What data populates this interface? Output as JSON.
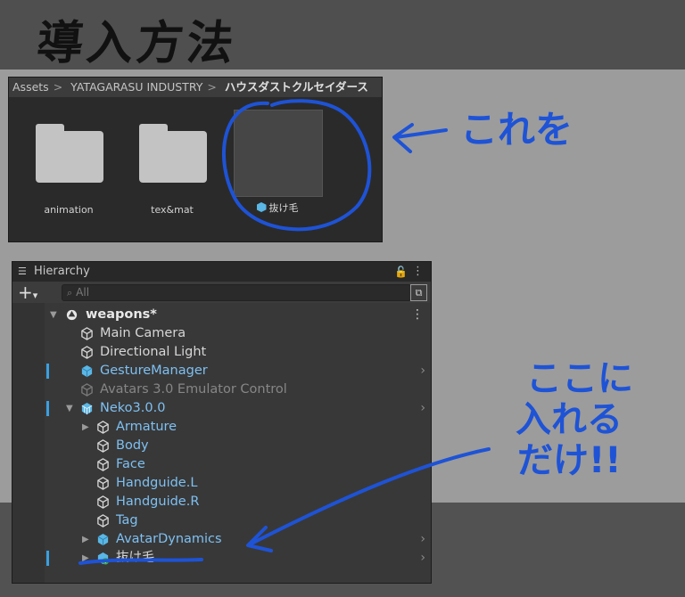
{
  "title": "導入方法",
  "project": {
    "breadcrumb": [
      "Assets",
      "YATAGARASU INDUSTRY",
      "ハウスダストクルセイダース"
    ],
    "items": [
      {
        "label": "animation",
        "type": "folder"
      },
      {
        "label": "tex&mat",
        "type": "folder"
      },
      {
        "label": "抜け毛",
        "type": "prefab"
      }
    ]
  },
  "hierarchy": {
    "tab_label": "Hierarchy",
    "search_placeholder": "All",
    "scene": "weapons*",
    "rows": [
      {
        "label": "Main Camera",
        "icon": "gameobject-cube-icon",
        "style": "normal"
      },
      {
        "label": "Directional Light",
        "icon": "gameobject-cube-icon",
        "style": "normal"
      },
      {
        "label": "GestureManager",
        "icon": "prefab-cube-icon",
        "style": "prefab"
      },
      {
        "label": "Avatars 3.0 Emulator Control",
        "icon": "gameobject-cube-icon",
        "style": "disabled"
      },
      {
        "label": "Neko3.0.0",
        "icon": "prefab-model-icon",
        "style": "prefab"
      },
      {
        "label": "Armature",
        "icon": "gameobject-cube-icon",
        "style": "prefab"
      },
      {
        "label": "Body",
        "icon": "gameobject-cube-icon",
        "style": "prefab"
      },
      {
        "label": "Face",
        "icon": "gameobject-cube-icon",
        "style": "prefab"
      },
      {
        "label": "Handguide.L",
        "icon": "gameobject-cube-icon",
        "style": "prefab"
      },
      {
        "label": "Handguide.R",
        "icon": "gameobject-cube-icon",
        "style": "prefab"
      },
      {
        "label": "Tag",
        "icon": "gameobject-cube-icon",
        "style": "prefab"
      },
      {
        "label": "AvatarDynamics",
        "icon": "prefab-cube-icon",
        "style": "prefab"
      },
      {
        "label": "抜け毛",
        "icon": "prefab-added-icon",
        "style": "prefab"
      }
    ]
  },
  "annotations": {
    "this_label": "これを",
    "instruction_line1": "ここに",
    "instruction_line2": "入れる",
    "instruction_line3": "だけ!!",
    "ink_color": "#1e53d6"
  }
}
